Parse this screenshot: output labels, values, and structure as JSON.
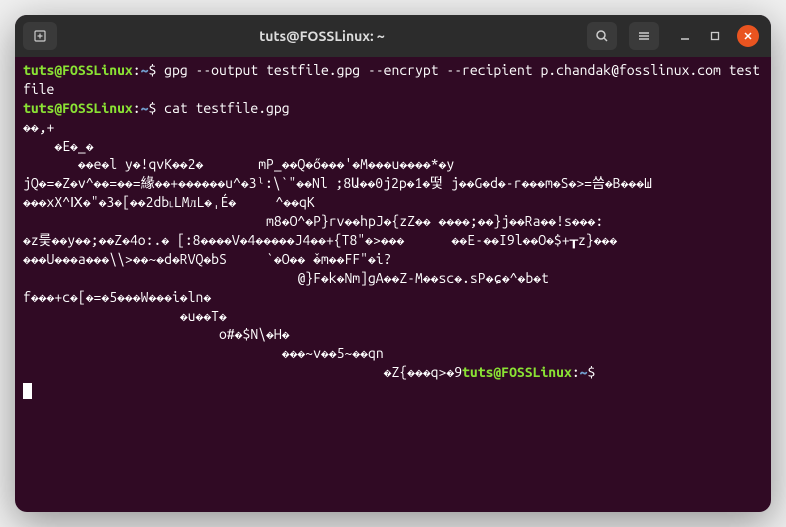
{
  "titlebar": {
    "title": "tuts@FOSSLinux: ~"
  },
  "prompt": {
    "user_host": "tuts@FOSSLinux",
    "colon": ":",
    "path": "~",
    "dollar": "$ "
  },
  "commands": {
    "cmd1": "gpg --output testfile.gpg --encrypt --recipient p.chandak@fosslinux.com testfile",
    "cmd2": "cat testfile.gpg"
  },
  "output": {
    "line1": "��,+",
    "line2": "    �E�_�",
    "line3": "       ��e�l y�!qvK��2�       mP_��Q�ő���'�M���u����*�y",
    "line4": "jQ�=�Z�v^��=��=緣��+������u^�3ˡ:\\`\"��Nl ;8Ա��0j2p�1�떷 j��G�d�-r���m�S�>=씀�B���Ш",
    "line5": "���xX^Ⅸ�\"�3�[��2db˪LMᴫL�ˌÉ�     ^��qK",
    "line6": "                               m8�O^�P}rv��hpJ�{zZ�� ����;��}j��Ra��!s���:",
    "line7": "�z릋��y��;��Z�4o:.� [:8����V�4�����J4��+{T8\"�>���      ��E˗��I9l��O�$+┰z}���",
    "line8": "���U���a���\\\\>��~�d�RVQ�bS     `�O�� ̌�m��FF\"�i?",
    "line9": "                                   @}F�k�Nm]gA��Z-M��sc�.sP�ɕ�^�b�t",
    "line10": "f���+c�[�=�5���W���i�ln�",
    "line11": "                    �u��T�",
    "line12": "                         o#�$N\\�H�",
    "line13": "                                 ���~v��5~��qn",
    "line14_prefix": "                                              �Z{���q>�9"
  }
}
